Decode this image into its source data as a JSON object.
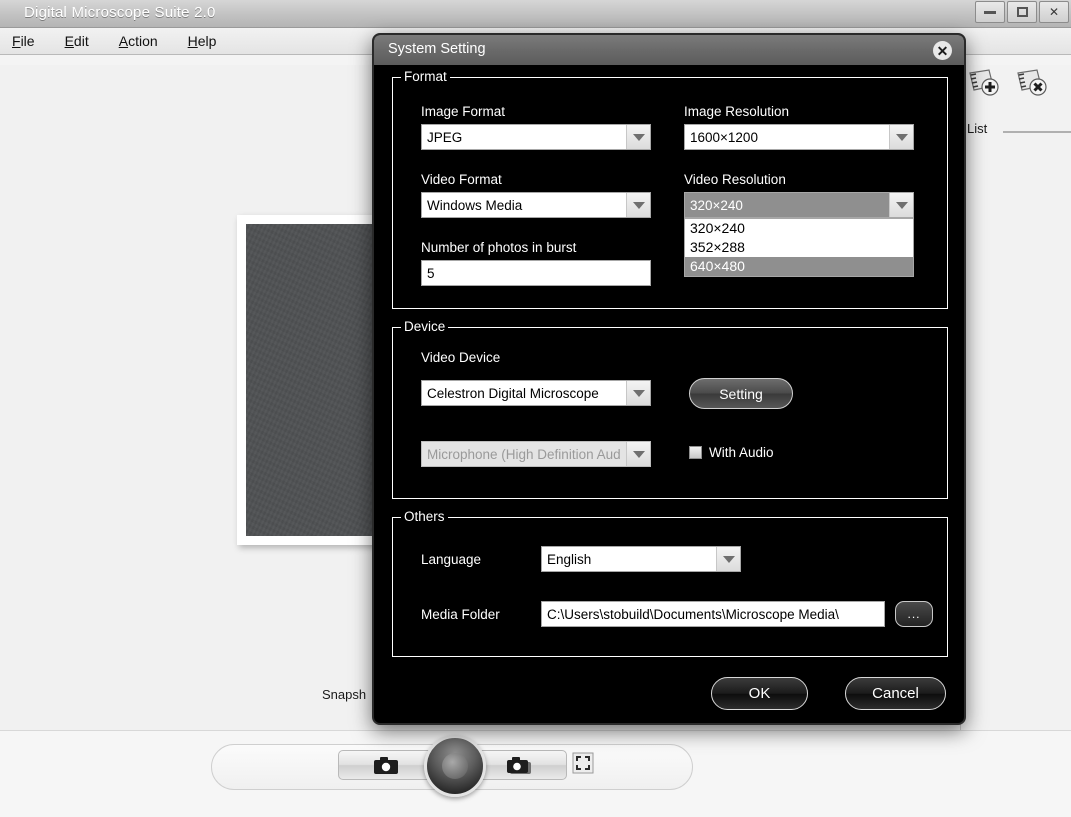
{
  "app": {
    "title": "Digital Microscope Suite 2.0",
    "window_controls": [
      {
        "name": "minimize",
        "glyph": "–"
      },
      {
        "name": "maximize",
        "glyph": "□"
      },
      {
        "name": "close",
        "glyph": "×"
      }
    ],
    "menu": [
      {
        "label": "File",
        "accel": "F"
      },
      {
        "label": "Edit",
        "accel": "E"
      },
      {
        "label": "Action",
        "accel": "A"
      },
      {
        "label": "Help",
        "accel": "H"
      }
    ],
    "snapshot_label": "Snapsh",
    "list_panel": {
      "label": "List",
      "icons": [
        {
          "name": "add-to-list-icon"
        },
        {
          "name": "remove-from-list-icon"
        }
      ]
    },
    "bottom_controls": {
      "snapshot_button": "camera-icon",
      "burst_button": "camera-burst-icon",
      "record_button": "record-knob",
      "fullscreen_button": "fullscreen-icon"
    }
  },
  "dialog": {
    "title": "System Setting",
    "close_label": "✕",
    "groups": {
      "format": {
        "title": "Format",
        "image_format": {
          "label": "Image Format",
          "value": "JPEG"
        },
        "video_format": {
          "label": "Video Format",
          "value": "Windows Media"
        },
        "burst": {
          "label": "Number of photos in burst",
          "value": "5"
        },
        "image_resolution": {
          "label": "Image Resolution",
          "value": "1600×1200"
        },
        "video_resolution": {
          "label": "Video Resolution",
          "value": "320×240",
          "open": true,
          "options": [
            {
              "label": "320×240",
              "selected": false
            },
            {
              "label": "352×288",
              "selected": false
            },
            {
              "label": "640×480",
              "selected": true
            }
          ]
        }
      },
      "device": {
        "title": "Device",
        "video_device": {
          "label": "Video Device",
          "value": "Celestron Digital Microscope"
        },
        "setting_button": "Setting",
        "audio_device": {
          "value": "Microphone (High Definition Aud",
          "disabled": true
        },
        "with_audio": {
          "label": "With Audio",
          "checked": false
        }
      },
      "others": {
        "title": "Others",
        "language": {
          "label": "Language",
          "value": "English"
        },
        "media_folder": {
          "label": "Media Folder",
          "value": "C:\\Users\\stobuild\\Documents\\Microscope Media\\",
          "browse_label": "..."
        }
      }
    },
    "buttons": {
      "ok": "OK",
      "cancel": "Cancel"
    }
  },
  "colors": {
    "dialog_bg": "#000000",
    "dialog_titlebar": "#6a6a6a",
    "highlight": "#8f8f8f",
    "app_bg": "#f1f1f1",
    "preview": "#4f5153"
  }
}
